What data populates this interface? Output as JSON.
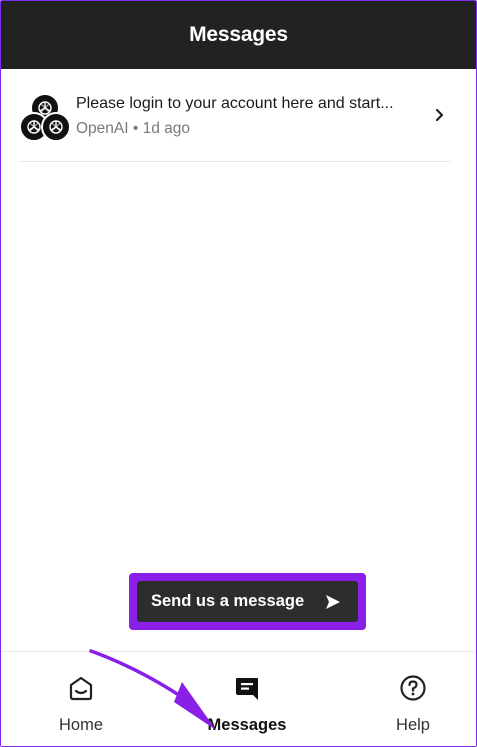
{
  "header": {
    "title": "Messages"
  },
  "conversation": {
    "title": "Please login to your account here and start...",
    "sender": "OpenAI",
    "separator": "•",
    "time": "1d ago",
    "avatar_icon": "openai-logo-icon",
    "chevron_icon": "chevron-right-icon"
  },
  "send_button": {
    "label": "Send us a message",
    "icon": "send-arrow-icon"
  },
  "nav": {
    "items": [
      {
        "label": "Home",
        "icon": "home-icon"
      },
      {
        "label": "Messages",
        "icon": "messages-icon",
        "active": true
      },
      {
        "label": "Help",
        "icon": "help-icon"
      }
    ]
  },
  "colors": {
    "header_bg": "#222222",
    "highlight": "#8a1fe8",
    "button_bg": "#2d2d2d",
    "muted_text": "#7a7a7a"
  }
}
